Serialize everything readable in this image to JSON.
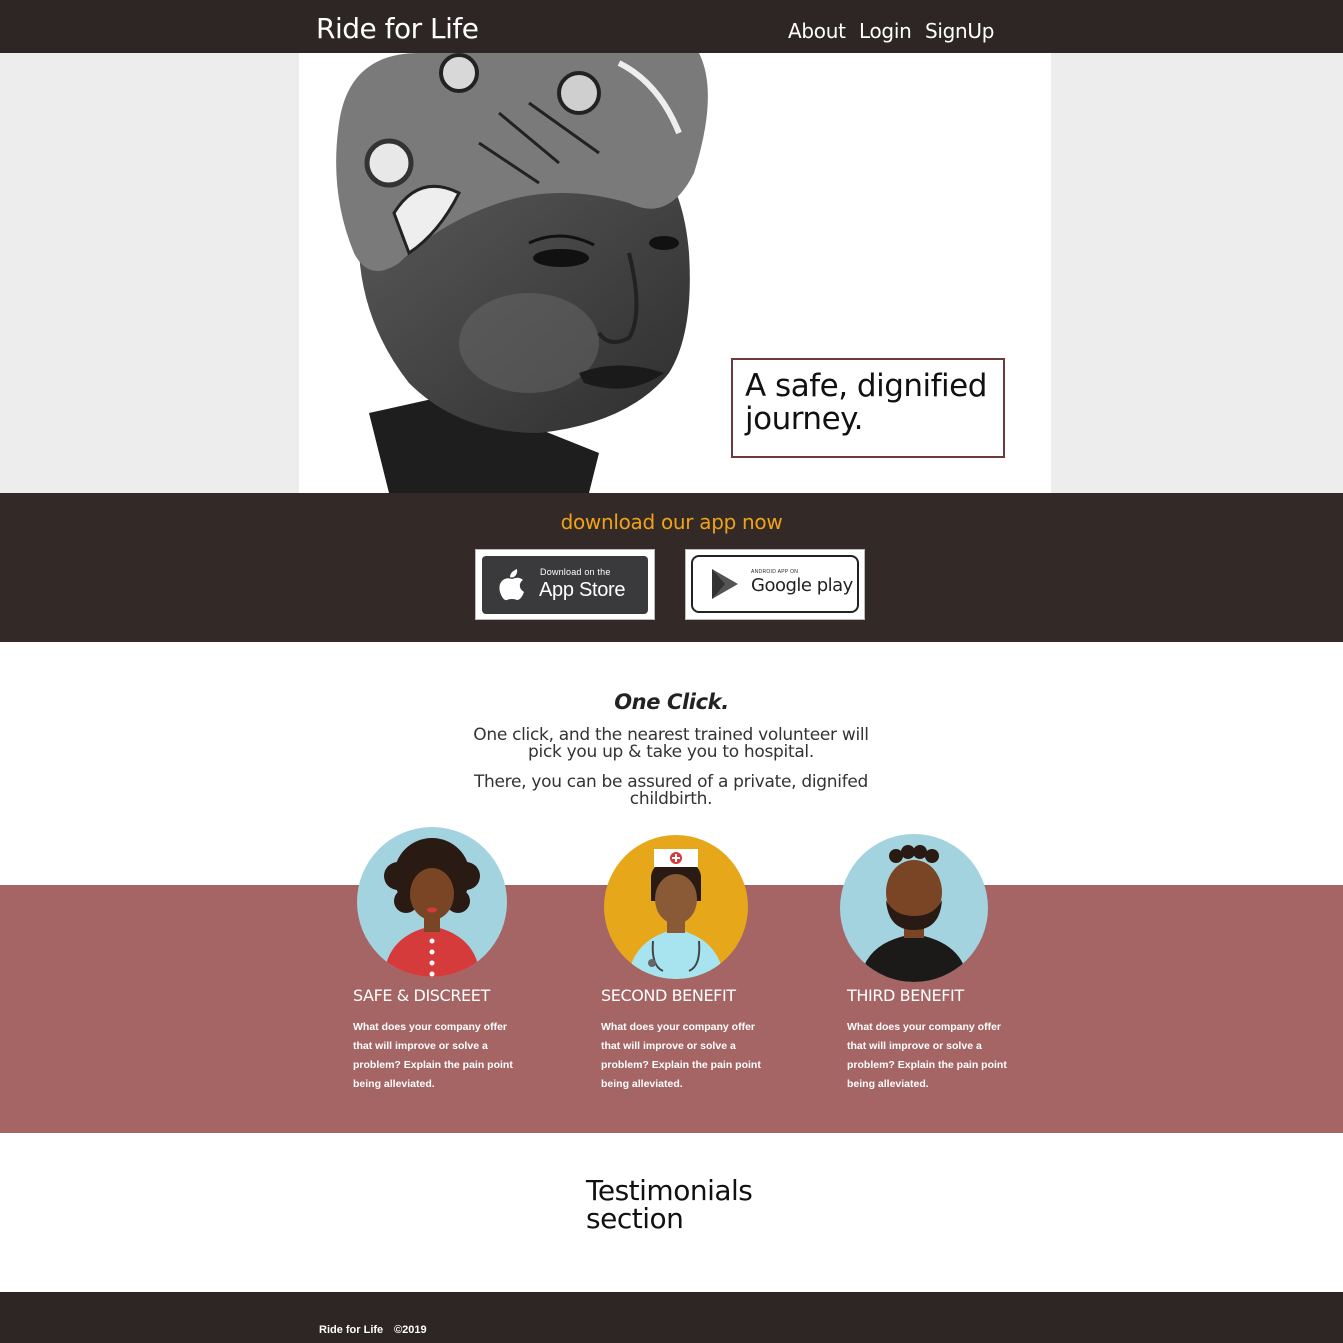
{
  "navbar": {
    "brand": "Ride for Life",
    "links": [
      {
        "label": "About"
      },
      {
        "label": "Login"
      },
      {
        "label": "SignUp"
      }
    ]
  },
  "hero": {
    "tagline": "A safe, dignified journey."
  },
  "download": {
    "title": "download our app now",
    "appstore": {
      "small": "Download on the",
      "big": "App Store"
    },
    "googleplay": {
      "small": "ANDROID APP ON",
      "big": "Google play"
    }
  },
  "one_click": {
    "title": "One Click.",
    "paragraphs": [
      "One click, and the nearest trained volunteer will pick you up & take you to hospital.",
      "There, you can be assured of a private, dignifed childbirth."
    ]
  },
  "benefits": [
    {
      "title": "SAFE & DISCREET",
      "text": "What does your company offer that will improve or solve a problem? Explain the pain point being alleviated."
    },
    {
      "title": "SECOND BENEFIT",
      "text": "What does your company offer that will improve or solve a problem? Explain the pain point being alleviated."
    },
    {
      "title": "THIRD BENEFIT",
      "text": "What does your company offer that will improve or solve a problem? Explain the pain point being alleviated."
    }
  ],
  "testimonials": {
    "title": "Testimonials section"
  },
  "footer": {
    "brand": "Ride for Life",
    "copyright": "©2019"
  },
  "colors": {
    "nav_bg": "#2d2624",
    "download_bg": "#332a28",
    "accent_orange": "#f0a21a",
    "benefit_bg": "#a56565",
    "tagline_border": "#6b3a3a"
  }
}
